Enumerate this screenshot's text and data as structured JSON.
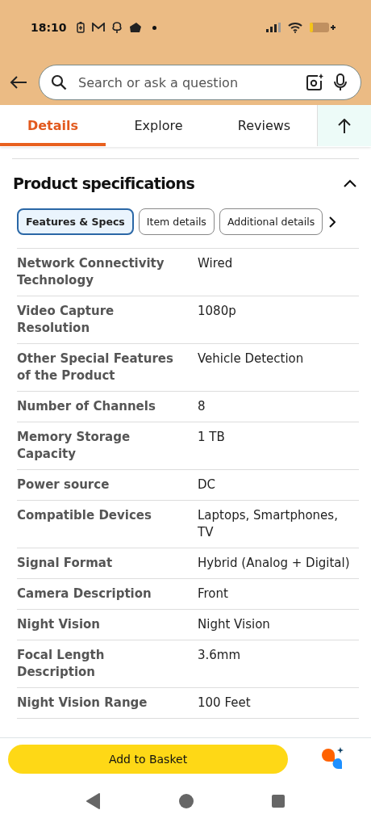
{
  "status_bar": {
    "time": "18:10"
  },
  "search": {
    "placeholder": "Search or ask a question"
  },
  "tabs": [
    {
      "label": "Details",
      "selected": true
    },
    {
      "label": "Explore",
      "selected": false
    },
    {
      "label": "Reviews",
      "selected": false
    }
  ],
  "section": {
    "title": "Product specifications",
    "expanded": true
  },
  "chips": [
    {
      "label": "Features & Specs",
      "selected": true
    },
    {
      "label": "Item details",
      "selected": false
    },
    {
      "label": "Additional details",
      "selected": false
    }
  ],
  "specs": [
    {
      "name": "Network Connectivity Technology",
      "value": "Wired"
    },
    {
      "name": "Video Capture Resolution",
      "value": "1080p"
    },
    {
      "name": "Other Special Features of the Product",
      "value": "Vehicle Detection"
    },
    {
      "name": "Number of Channels",
      "value": "8"
    },
    {
      "name": "Memory Storage Capacity",
      "value": "1 TB"
    },
    {
      "name": "Power source",
      "value": "DC"
    },
    {
      "name": "Compatible Devices",
      "value": "Laptops, Smartphones, TV"
    },
    {
      "name": "Signal Format",
      "value": "Hybrid (Analog + Digital)"
    },
    {
      "name": "Camera Description",
      "value": "Front"
    },
    {
      "name": "Night Vision",
      "value": "Night Vision"
    },
    {
      "name": "Focal Length Description",
      "value": "3.6mm"
    },
    {
      "name": "Night Vision Range",
      "value": "100 Feet"
    }
  ],
  "add_button": "Add to Basket"
}
